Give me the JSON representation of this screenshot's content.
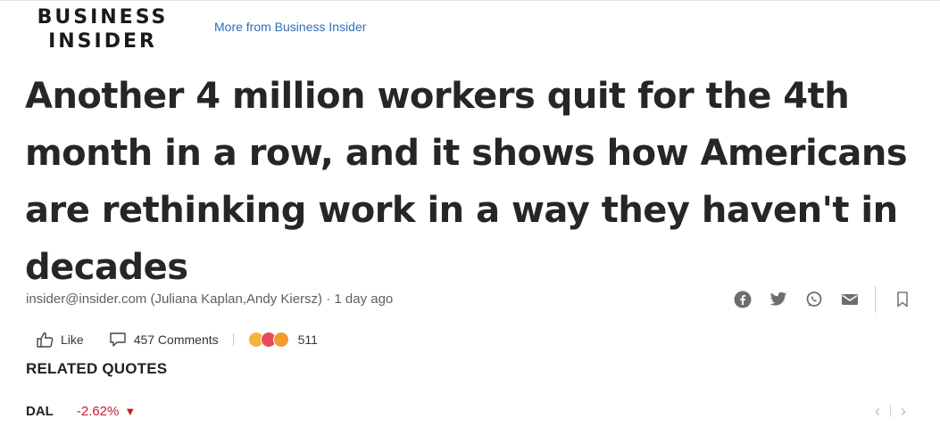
{
  "header": {
    "logo_line1": "BUSINESS",
    "logo_line2": "INSIDER",
    "more_from": "More from Business Insider"
  },
  "article": {
    "headline": "Another 4 million workers quit for the 4th month in a row, and it shows how Americans are rethinking work in a way they haven't in decades",
    "byline": "insider@insider.com (Juliana Kaplan,Andy Kiersz) · 1 day ago"
  },
  "share": {
    "icons": [
      "facebook-icon",
      "twitter-icon",
      "whatsapp-icon",
      "email-icon",
      "bookmark-icon"
    ]
  },
  "actions": {
    "like_label": "Like",
    "comments_label": "457 Comments",
    "reactions_count": "511",
    "reaction_icons": [
      "thumbs-up",
      "heart",
      "angry-face"
    ]
  },
  "related": {
    "title": "RELATED QUOTES",
    "quotes": [
      {
        "ticker": "DAL",
        "change": "-2.62%",
        "direction": "down"
      }
    ]
  },
  "colors": {
    "link": "#2f6fb5",
    "negative": "#c0202f",
    "headline": "#262626"
  }
}
